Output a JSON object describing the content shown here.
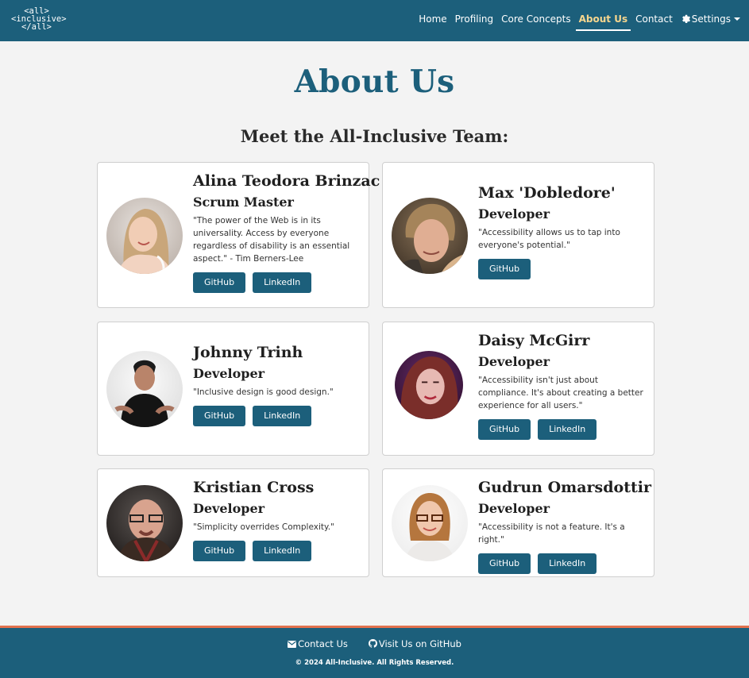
{
  "nav": {
    "logo_lines": [
      "<all>",
      "<inclusive>",
      "</all>"
    ],
    "links": [
      "Home",
      "Profiling",
      "Core Concepts",
      "About Us",
      "Contact"
    ],
    "settings_label": "Settings",
    "active": "About Us"
  },
  "page": {
    "title": "About Us",
    "subtitle": "Meet the All-Inclusive Team:"
  },
  "team": [
    {
      "name": "Alina Teodora Brinzac",
      "role": "Scrum Master",
      "quote": "\"The power of the Web is in its universality. Access by everyone regardless of disability is an essential aspect.\" - Tim Berners-Lee",
      "buttons": [
        "GitHub",
        "LinkedIn"
      ],
      "photo": "woman-blonde-hair-photo"
    },
    {
      "name": "Max 'Dobledore'",
      "role": "Developer",
      "quote": "\"Accessibility allows us to tap into everyone's potential.\"",
      "buttons": [
        "GitHub"
      ],
      "photo": "man-curly-hair-photo"
    },
    {
      "name": "Johnny Trinh",
      "role": "Developer",
      "quote": "\"Inclusive design is good design.\"",
      "buttons": [
        "GitHub",
        "LinkedIn"
      ],
      "photo": "man-black-shirt-photo"
    },
    {
      "name": "Daisy McGirr",
      "role": "Developer",
      "quote": "\"Accessibility isn't just about compliance. It's about creating a better experience for all users.\"",
      "buttons": [
        "GitHub",
        "LinkedIn"
      ],
      "photo": "woman-red-hair-photo"
    },
    {
      "name": "Kristian Cross",
      "role": "Developer",
      "quote": "\"Simplicity overrides Complexity.\"",
      "buttons": [
        "GitHub",
        "LinkedIn"
      ],
      "photo": "man-glasses-photo"
    },
    {
      "name": "Gudrun Omarsdottir",
      "role": "Developer",
      "quote": "\"Accessibility is not a feature. It's a right.\"",
      "buttons": [
        "GitHub",
        "LinkedIn"
      ],
      "photo": "woman-glasses-photo"
    }
  ],
  "footer": {
    "contact_label": "Contact Us",
    "github_label": "Visit Us on GitHub",
    "copyright": "© 2024 All-Inclusive. All Rights Reserved."
  },
  "colors": {
    "primary": "#1c5f7b",
    "active_nav": "#f6d68e",
    "footer_accent": "#e2714d",
    "background": "#f3f3f3"
  }
}
